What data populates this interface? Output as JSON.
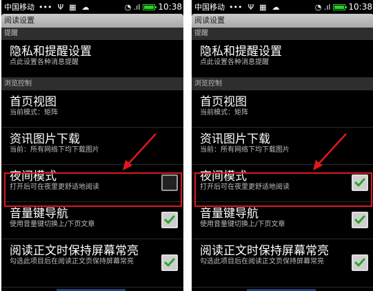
{
  "status": {
    "carrier": "中国移动",
    "left_glyphs": [
      "•••",
      "Ψ",
      "▦",
      "☁"
    ],
    "signal": "◔ .ıl",
    "time": "10:38"
  },
  "screen": {
    "title": "阅读设置",
    "section_reminder": "提醒",
    "privacy": {
      "title": "隐私和提醒设置",
      "subtitle": "点此设置各种消息提醒"
    },
    "section_browse": "浏览控制",
    "home_view": {
      "title": "首页视图",
      "subtitle": "当前模式：矩阵"
    },
    "image_download": {
      "title": "资讯图片下载",
      "subtitle": "当前：所有网络下均下载图片"
    },
    "night_mode": {
      "title": "夜间模式",
      "subtitle": "打开后可在夜里更舒适地阅读"
    },
    "volume_nav": {
      "title": "音量键导航",
      "subtitle": "使用音量键切换上/下页文章"
    },
    "screen_on": {
      "title": "阅读正文时保持屏幕常亮",
      "subtitle": "勾选此项目后在阅读正文页保持屏幕常亮"
    }
  },
  "panels": [
    {
      "night_mode_checked": false,
      "volume_nav_checked": true,
      "screen_on_checked": true
    },
    {
      "night_mode_checked": true,
      "volume_nav_checked": true,
      "screen_on_checked": true
    }
  ],
  "colors": {
    "highlight": "#e0181d",
    "check": "#2aa52a",
    "battery": "#2bd12b"
  },
  "battery_level": 0.85
}
